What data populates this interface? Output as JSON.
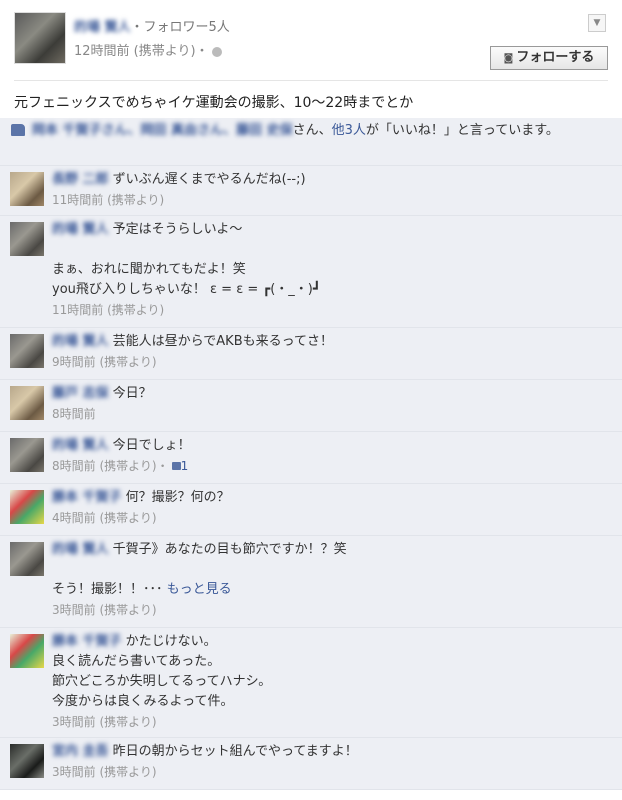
{
  "post": {
    "author_name": "的場 賢人",
    "follower_text": "・フォロワー5人",
    "meta": "12時間前 (携帯より)・",
    "follow_label": "フォローする",
    "text": "元フェニックスでめちゃイケ運動会の撮影、10〜22時までとか"
  },
  "likes": {
    "names": "岡本 千賀子さん、岡田 真由さん、藤田 史保",
    "mid": "さん、",
    "others": "他3人",
    "suffix": "が「いいね！」と言っています。"
  },
  "comments": [
    {
      "name": "長野 二郎",
      "text": "ずいぶん遅くまでやるんだね(--;)",
      "meta": "11時間前 (携帯より)"
    },
    {
      "name": "的場 賢人",
      "lines": [
        "予定はそうらしいよ〜",
        "",
        "まぁ、おれに聞かれてもだよ！笑",
        "you飛び入りしちゃいな！ ε = ε = ┏(・_・)┛"
      ],
      "meta": "11時間前 (携帯より)"
    },
    {
      "name": "的場 賢人",
      "text": "芸能人は昼からでAKBも来るってさ！",
      "meta": "9時間前 (携帯より)"
    },
    {
      "name": "藤戸 志保",
      "text": "今日？",
      "meta": "8時間前"
    },
    {
      "name": "的場 賢人",
      "text": "今日でしょ！",
      "meta": "8時間前 (携帯より)・",
      "likes": "1"
    },
    {
      "name": "勝本 千賀子",
      "text": "何？撮影？何の？",
      "meta": "4時間前 (携帯より)"
    },
    {
      "name": "的場 賢人",
      "lines": [
        "千賀子》あなたの目も節穴ですか！？笑",
        "",
        "そう！撮影！！･･･"
      ],
      "more": "もっと見る",
      "meta": "3時間前 (携帯より)"
    },
    {
      "name": "勝本 千賀子",
      "lines": [
        "かたじけない。",
        "良く読んだら書いてあった。",
        "節穴どころか失明してるってハナシ。",
        "今度からは良くみるよって件。"
      ],
      "meta": "3時間前 (携帯より)"
    },
    {
      "name": "宮内 圭吾",
      "text": "昨日の朝からセット組んでやってますよ！",
      "meta": "3時間前 (携帯より)"
    }
  ]
}
